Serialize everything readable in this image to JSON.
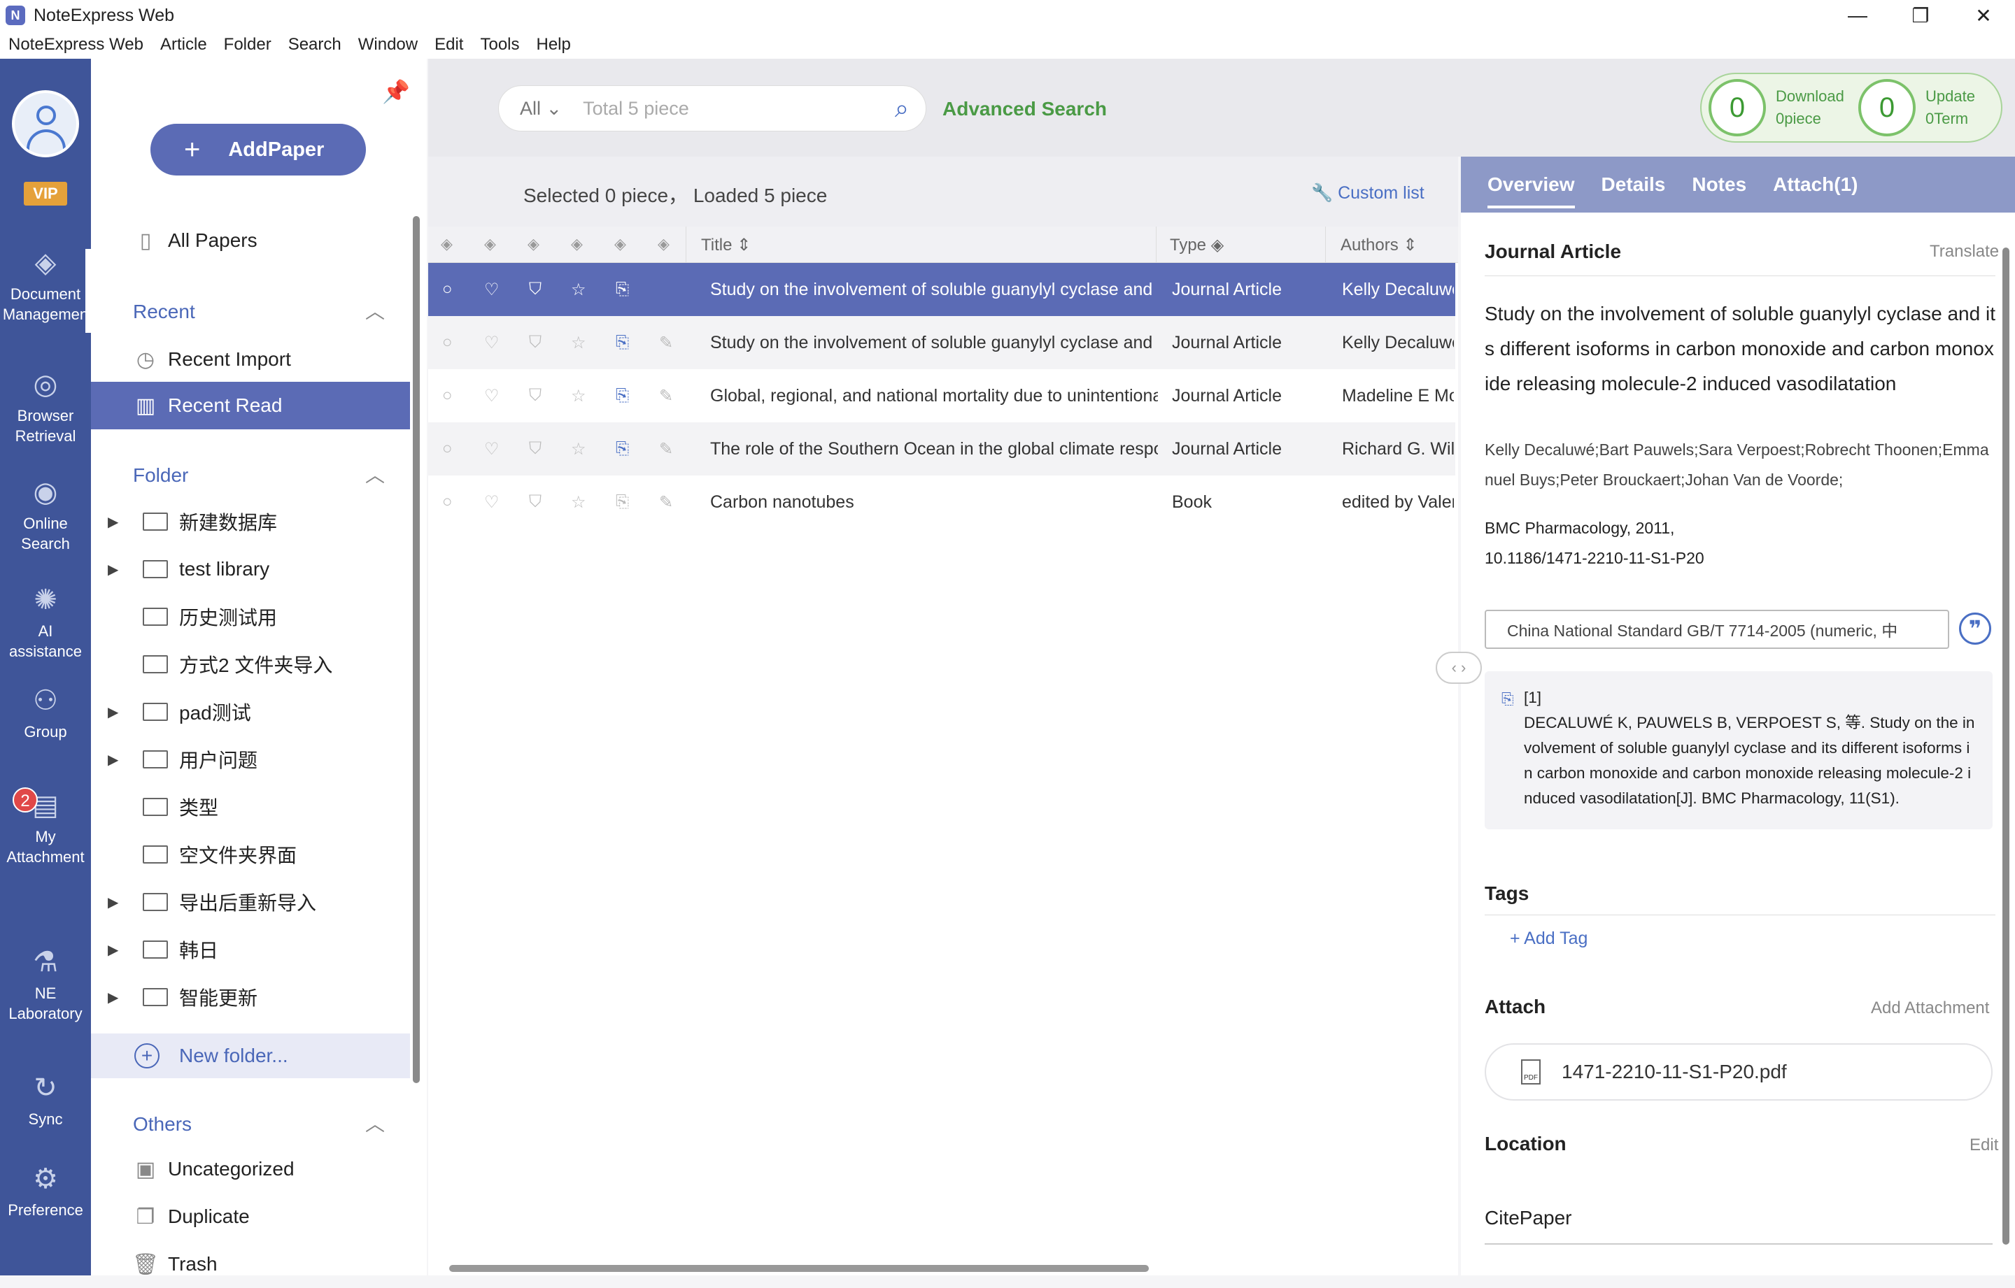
{
  "window": {
    "title": "NoteExpress Web",
    "minimize": "—",
    "restore": "❐",
    "close": "✕"
  },
  "menu": [
    "NoteExpress Web",
    "Article",
    "Folder",
    "Search",
    "Window",
    "Edit",
    "Tools",
    "Help"
  ],
  "rail": {
    "vip": "VIP",
    "items": [
      {
        "label1": "Document",
        "label2": "Managemen",
        "icon": "layers-icon"
      },
      {
        "label1": "Browser",
        "label2": "Retrieval",
        "icon": "globe-icon"
      },
      {
        "label1": "Online",
        "label2": "Search",
        "icon": "eye-icon"
      },
      {
        "label1": "AI assistance",
        "label2": "",
        "icon": "ai-bulb-icon"
      },
      {
        "label1": "Group",
        "label2": "",
        "icon": "group-icon"
      },
      {
        "label1": "My",
        "label2": "Attachment",
        "icon": "attachment-folder-icon",
        "badge": "2"
      },
      {
        "label1": "NE",
        "label2": "Laboratory",
        "icon": "microscope-icon"
      },
      {
        "label1": "Sync",
        "label2": "",
        "icon": "sync-icon"
      },
      {
        "label1": "Preference",
        "label2": "",
        "icon": "gear-icon"
      }
    ]
  },
  "left": {
    "add_paper": "AddPaper",
    "all_papers": "All Papers",
    "recent_header": "Recent",
    "recent_import": "Recent Import",
    "recent_read": "Recent Read",
    "folder_header": "Folder",
    "folders": [
      {
        "name": "新建数据库",
        "expandable": true
      },
      {
        "name": "test library",
        "expandable": true
      },
      {
        "name": "历史测试用",
        "expandable": false
      },
      {
        "name": "方式2 文件夹导入",
        "expandable": false
      },
      {
        "name": "pad测试",
        "expandable": true
      },
      {
        "name": "用户问题",
        "expandable": true
      },
      {
        "name": "类型",
        "expandable": false
      },
      {
        "name": "空文件夹界面",
        "expandable": false
      },
      {
        "name": "导出后重新导入",
        "expandable": true
      },
      {
        "name": "韩日",
        "expandable": true
      },
      {
        "name": "智能更新",
        "expandable": true
      }
    ],
    "new_folder": "New folder...",
    "others_header": "Others",
    "uncategorized": "Uncategorized",
    "duplicate": "Duplicate",
    "trash": "Trash"
  },
  "search": {
    "scope": "All",
    "placeholder": "Total 5 piece",
    "advanced": "Advanced Search"
  },
  "counters": {
    "download_count": "0",
    "download_label": "Download",
    "download_sub": "0piece",
    "update_count": "0",
    "update_label": "Update",
    "update_sub": "0Term"
  },
  "list": {
    "status": "Selected 0 piece， Loaded 5 piece",
    "custom_list": "Custom list",
    "columns": {
      "title": "Title",
      "type": "Type",
      "authors": "Authors"
    },
    "rows": [
      {
        "title": "Study on the involvement of soluble guanylyl cyclase and its different isoforms",
        "type": "Journal Article",
        "authors": "Kelly Decaluwé"
      },
      {
        "title": "Study on the involvement of soluble guanylyl cyclase and its different isoforms",
        "type": "Journal Article",
        "authors": "Kelly Decaluwé"
      },
      {
        "title": "Global, regional, and national mortality due to unintentional",
        "type": "Journal Article",
        "authors": "Madeline E Mo"
      },
      {
        "title": "The role of the Southern Ocean in the global climate response",
        "type": "Journal Article",
        "authors": "Richard G. Willi"
      },
      {
        "title": "Carbon nanotubes",
        "type": "Book",
        "authors": "edited by Valen"
      }
    ]
  },
  "detail": {
    "tabs": [
      "Overview",
      "Details",
      "Notes",
      "Attach(1)"
    ],
    "type": "Journal Article",
    "translate": "Translate",
    "title": "Study on the involvement of soluble guanylyl cyclase and its different isoforms in carbon monoxide and carbon monoxide releasing molecule-2 induced vasodilatation",
    "authors": "Kelly Decaluwé;Bart Pauwels;Sara Verpoest;Robrecht Thoonen;Emmanuel Buys;Peter Brouckaert;Johan Van de Voorde;",
    "source": "BMC Pharmacology, 2011,",
    "doi": "10.1186/1471-2210-11-S1-P20",
    "citation_style": "China National Standard GB/T 7714-2005 (numeric, 中",
    "citation_num": "[1]",
    "citation_text": "DECALUWÉ K, PAUWELS B, VERPOEST S, 等. Study on the involvement of soluble guanylyl cyclase and its different isoforms in carbon monoxide and carbon monoxide releasing molecule-2 induced vasodilatation[J]. BMC Pharmacology, 11(S1).",
    "tags_header": "Tags",
    "add_tag": "+ Add Tag",
    "attach_header": "Attach",
    "add_attachment": "Add Attachment",
    "attachment_file": "1471-2210-11-S1-P20.pdf",
    "location_header": "Location",
    "location_edit": "Edit",
    "location_value": "CitePaper"
  },
  "colors": {
    "rail": "#3f5599",
    "accent": "#5b6bb5",
    "green": "#4a9a45",
    "vip": "#e5a13a"
  }
}
